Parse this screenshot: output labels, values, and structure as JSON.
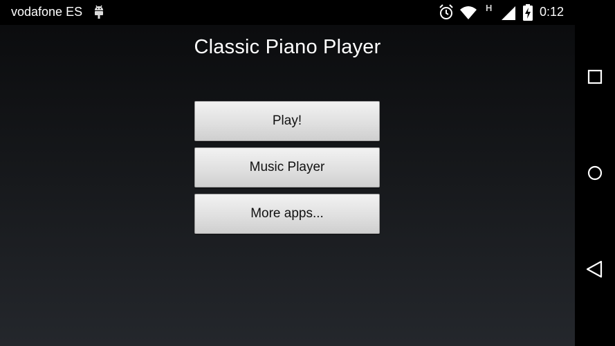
{
  "status_bar": {
    "carrier": "vodafone ES",
    "network_type": "H",
    "time": "0:12",
    "icons": [
      "android-debug-icon",
      "alarm-icon",
      "wifi-icon",
      "cellular-signal-icon",
      "battery-charging-icon"
    ]
  },
  "app": {
    "title": "Classic Piano Player",
    "buttons": {
      "play": "Play!",
      "music_player": "Music Player",
      "more_apps": "More apps..."
    }
  },
  "nav_bar": {
    "icons": [
      "recent-apps-icon",
      "home-icon",
      "back-icon"
    ]
  },
  "colors": {
    "background_top": "#0b0c0e",
    "background_bottom": "#24272c",
    "button_face": "#e0e0e0",
    "text_light": "#ffffff"
  }
}
